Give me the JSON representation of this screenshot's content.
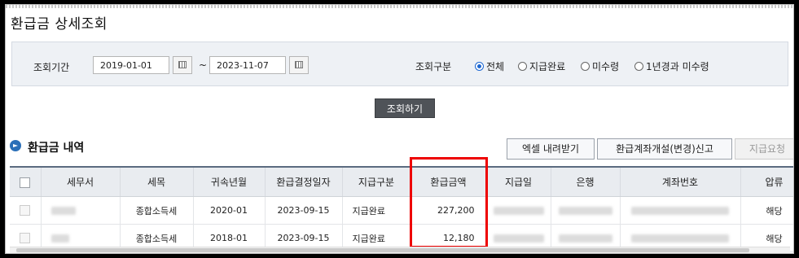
{
  "page_title": "환급금 상세조회",
  "search": {
    "period_label": "조회기간",
    "start_date": "2019-01-01",
    "tilde": "~",
    "end_date": "2023-11-07",
    "type_label": "조회구분",
    "options": [
      {
        "label": "전체",
        "selected": true
      },
      {
        "label": "지급완료",
        "selected": false
      },
      {
        "label": "미수령",
        "selected": false
      },
      {
        "label": "1년경과 미수령",
        "selected": false
      }
    ],
    "search_button": "조회하기"
  },
  "section": {
    "title": "환급금 내역",
    "buttons": {
      "excel": "엑셀 내려받기",
      "account": "환급계좌개설(변경)신고",
      "request": "지급요청"
    }
  },
  "table": {
    "columns": [
      "세무서",
      "세목",
      "귀속년월",
      "환급결정일자",
      "지급구분",
      "환급금액",
      "지급일",
      "은행",
      "계좌번호",
      "압류"
    ],
    "rows": [
      {
        "tax_office": "",
        "tax_item": "종합소득세",
        "period": "2020-01",
        "decision_date": "2023-09-15",
        "payment_type": "지급완료",
        "amount": "227,200",
        "pay_date": "",
        "bank": "",
        "account": "",
        "seizure": "해당"
      },
      {
        "tax_office": "",
        "tax_item": "종합소득세",
        "period": "2018-01",
        "decision_date": "2023-09-15",
        "payment_type": "지급완료",
        "amount": "12,180",
        "pay_date": "",
        "bank": "",
        "account": "",
        "seizure": "해당"
      }
    ]
  },
  "colors": {
    "accent": "#2a6fb8",
    "highlight": "#e00000",
    "search_btn": "#4f5358"
  }
}
